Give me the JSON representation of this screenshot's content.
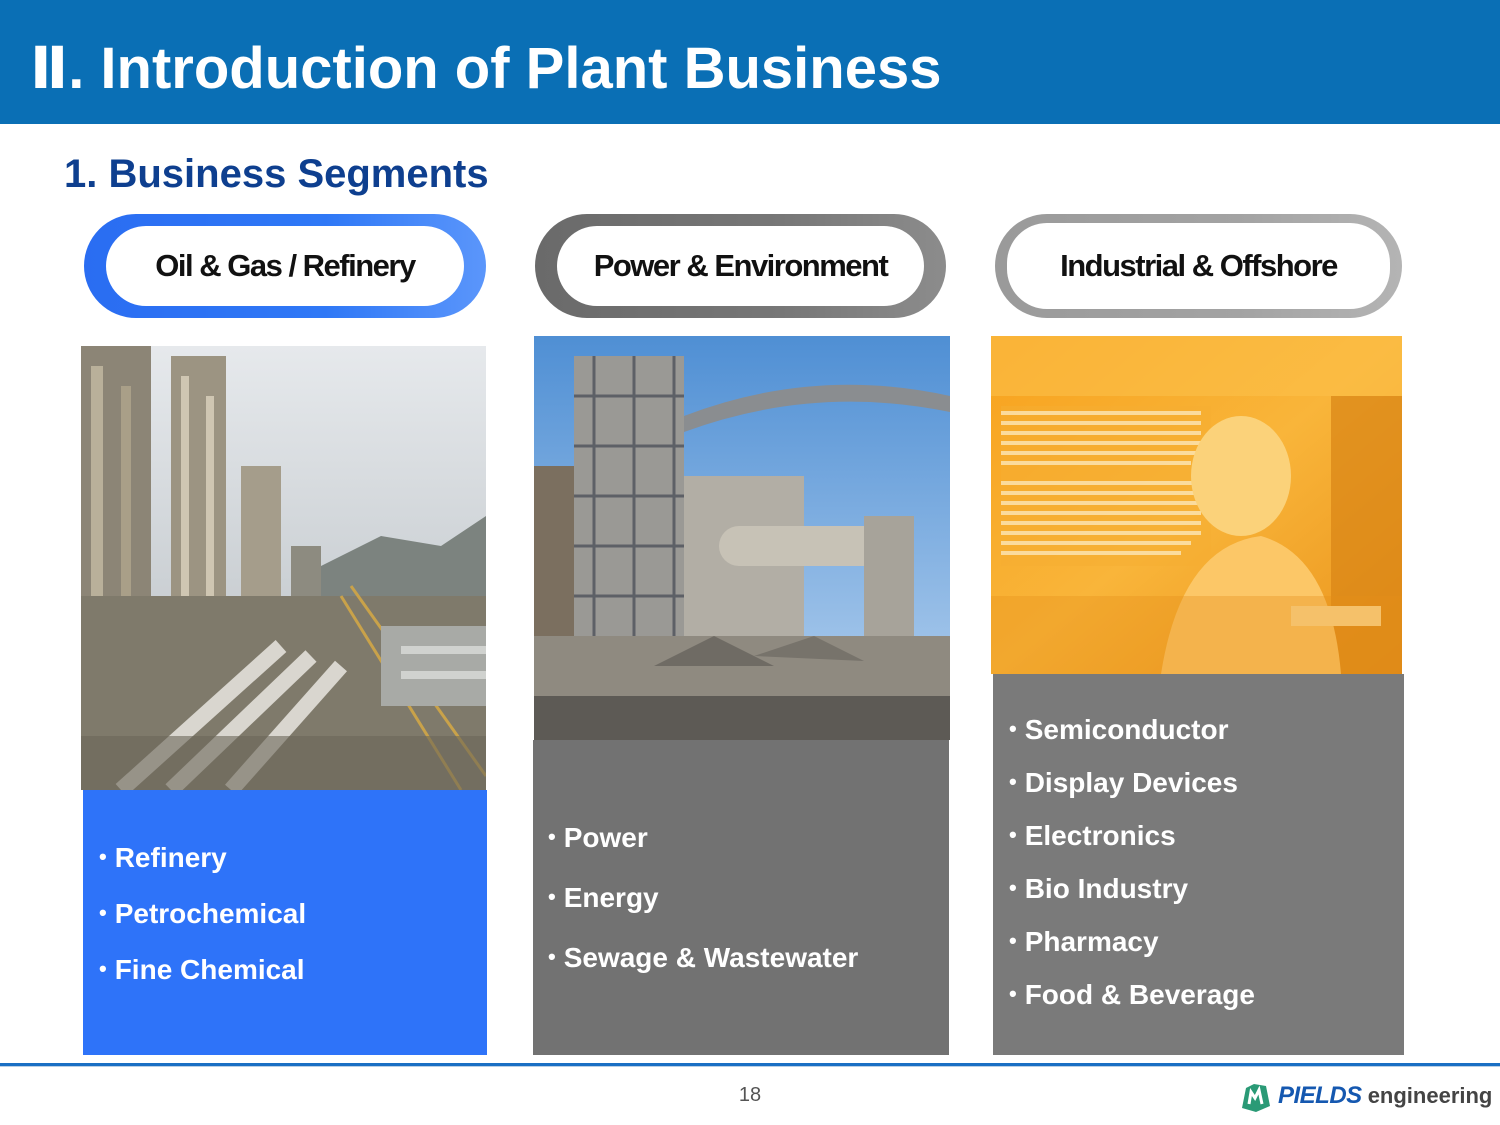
{
  "header": {
    "title": "Ⅱ. Introduction of Plant Business"
  },
  "section": {
    "title": "1. Business Segments"
  },
  "segments": [
    {
      "label": "Oil & Gas / Refinery",
      "items": [
        "Refinery",
        "Petrochemical",
        "Fine Chemical"
      ]
    },
    {
      "label": "Power & Environment",
      "items": [
        "Power",
        "Energy",
        "Sewage & Wastewater"
      ]
    },
    {
      "label": "Industrial & Offshore",
      "items": [
        "Semiconductor",
        "Display Devices",
        "Electronics",
        "Bio Industry",
        "Pharmacy",
        "Food & Beverage"
      ]
    }
  ],
  "footer": {
    "page_number": "18",
    "logo_brand": "PIELDS",
    "logo_sub": "engineering"
  },
  "colors": {
    "header": "#0a6fb5",
    "section_title": "#0e3f8f",
    "oil_gas_accent": "#2e73f9",
    "power_accent": "#727272",
    "industrial_accent": "#7a7a7a"
  }
}
